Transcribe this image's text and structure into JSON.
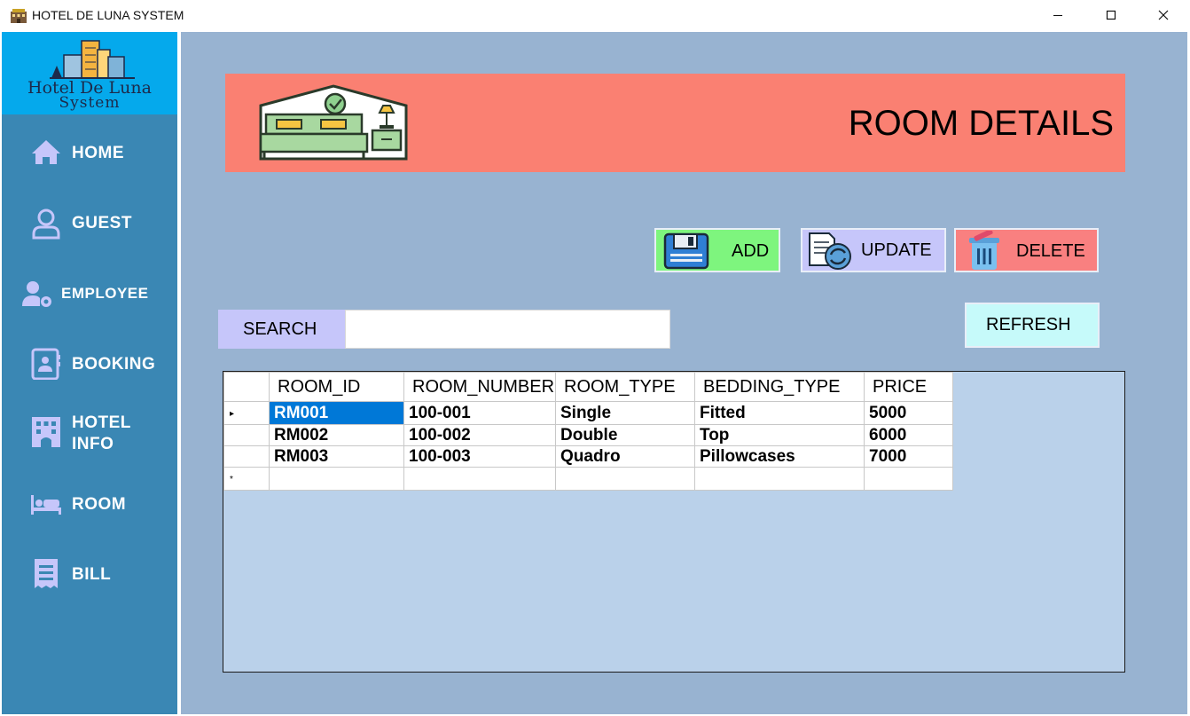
{
  "window": {
    "title": "HOTEL DE LUNA SYSTEM"
  },
  "logo": {
    "line1": "Hotel De Luna",
    "line2": "System"
  },
  "sidebar": {
    "items": [
      {
        "label": "HOME",
        "icon": "home-icon"
      },
      {
        "label": "GUEST",
        "icon": "user-icon"
      },
      {
        "label": "EMPLOYEE",
        "icon": "user-gear-icon"
      },
      {
        "label": "BOOKING",
        "icon": "contact-book-icon"
      },
      {
        "label": "HOTEL",
        "label2": "INFO",
        "icon": "hotel-building-icon"
      },
      {
        "label": "ROOM",
        "icon": "bed-icon"
      },
      {
        "label": "BILL",
        "icon": "receipt-icon"
      }
    ]
  },
  "header": {
    "title": "ROOM DETAILS",
    "icon": "hotel-room-icon"
  },
  "toolbar": {
    "add_label": "ADD",
    "update_label": "UPDATE",
    "delete_label": "DELETE",
    "refresh_label": "REFRESH"
  },
  "search": {
    "label": "SEARCH",
    "value": ""
  },
  "table": {
    "columns": [
      "ROOM_ID",
      "ROOM_NUMBER",
      "ROOM_TYPE",
      "BEDDING_TYPE",
      "PRICE"
    ],
    "rows": [
      [
        "RM001",
        "100-001",
        "Single",
        "Fitted",
        "5000"
      ],
      [
        "RM002",
        "100-002",
        "Double",
        "Top",
        "6000"
      ],
      [
        "RM003",
        "100-003",
        "Quadro",
        "Pillowcases",
        "7000"
      ]
    ],
    "selected_row": 0,
    "new_row_marker": "*"
  },
  "colors": {
    "sidebar": "#3a87b4",
    "logo_bg": "#05a9ec",
    "main_bg": "#98b3d1",
    "banner": "#fa8072",
    "add": "#7ef57e",
    "update": "#c6c6fa",
    "delete": "#f98080",
    "refresh": "#c6fafa",
    "grid_bg": "#bad1ea",
    "selection": "#0078d7"
  }
}
